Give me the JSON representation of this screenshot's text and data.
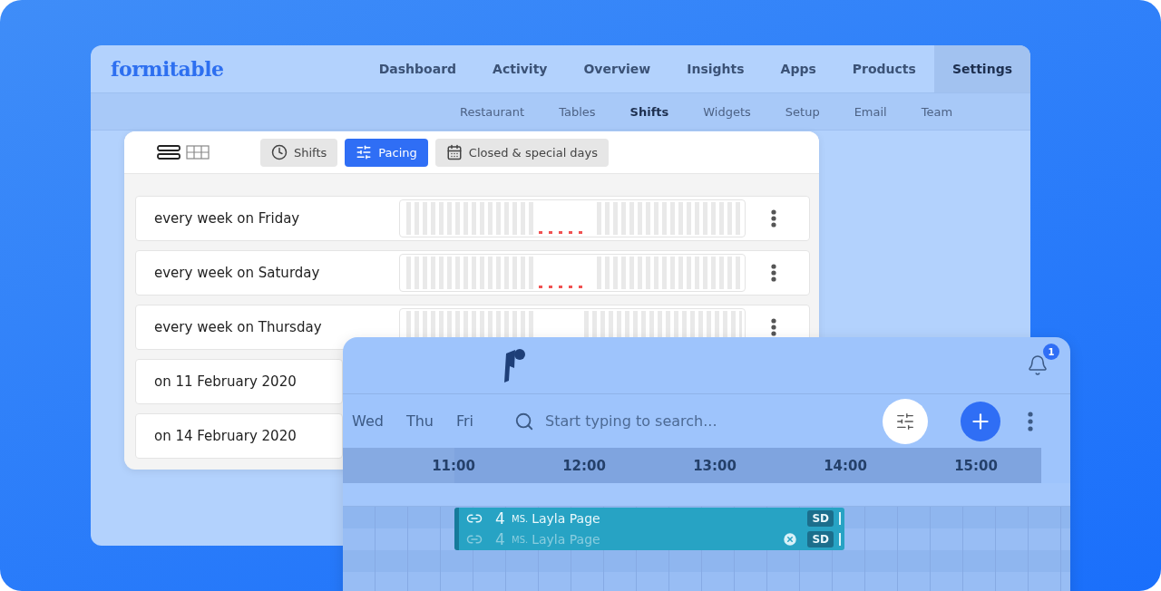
{
  "main_window": {
    "logo": "formitable",
    "nav": [
      {
        "label": "Dashboard",
        "selected": false
      },
      {
        "label": "Activity",
        "selected": false
      },
      {
        "label": "Overview",
        "selected": false
      },
      {
        "label": "Insights",
        "selected": false
      },
      {
        "label": "Apps",
        "selected": false
      },
      {
        "label": "Products",
        "selected": false
      },
      {
        "label": "Settings",
        "selected": true
      }
    ],
    "subnav": [
      {
        "label": "Restaurant",
        "selected": false
      },
      {
        "label": "Tables",
        "selected": false
      },
      {
        "label": "Shifts",
        "selected": true
      },
      {
        "label": "Widgets",
        "selected": false
      },
      {
        "label": "Setup",
        "selected": false
      },
      {
        "label": "Email",
        "selected": false
      },
      {
        "label": "Team",
        "selected": false
      }
    ],
    "panel": {
      "view_toggle": [
        {
          "kind": "list",
          "selected": true
        },
        {
          "kind": "grid",
          "selected": false
        }
      ],
      "tabs": [
        {
          "label": "Shifts",
          "kind": "clock",
          "selected": false
        },
        {
          "label": "Pacing",
          "kind": "sliders",
          "selected": true
        },
        {
          "label": "Closed & special days",
          "kind": "calendar",
          "selected": false
        }
      ],
      "rows": [
        {
          "label": "every week on Friday",
          "marked": true
        },
        {
          "label": "every week on Saturday",
          "marked": true
        },
        {
          "label": "every week on Thursday",
          "marked": false
        },
        {
          "label": "on 11 February 2020"
        },
        {
          "label": "on 14 February 2020"
        }
      ]
    }
  },
  "booking_window": {
    "notification_count": "1",
    "days": [
      "Wed",
      "Thu",
      "Fri"
    ],
    "search": {
      "placeholder": "Start typing to search..."
    },
    "times": [
      "11:00",
      "12:00",
      "13:00",
      "14:00",
      "15:00"
    ],
    "reservations": [
      {
        "party": "4",
        "title": "MS.",
        "name": "Layla Page",
        "tag": "SD",
        "cancelled": false
      },
      {
        "party": "4",
        "title": "MS.",
        "name": "Layla Page",
        "tag": "SD",
        "cancelled": true
      }
    ]
  }
}
